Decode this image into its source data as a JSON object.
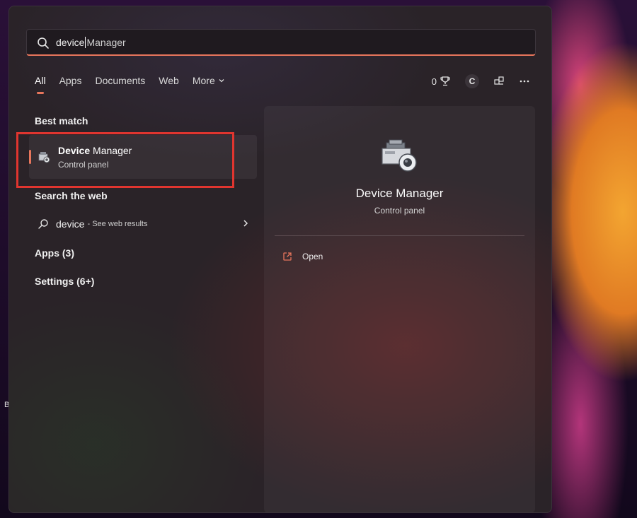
{
  "search": {
    "query_typed": "device",
    "query_suggest": " Manager"
  },
  "tabs": [
    {
      "label": "All",
      "active": true
    },
    {
      "label": "Apps"
    },
    {
      "label": "Documents"
    },
    {
      "label": "Web"
    },
    {
      "label": "More"
    }
  ],
  "header_icons": {
    "rewards_points": "0",
    "avatar_letter": "C"
  },
  "sections": {
    "best_match": "Best match",
    "search_web": "Search the web",
    "apps": "Apps (3)",
    "settings": "Settings (6+)"
  },
  "best_match": {
    "name_bold": "Device",
    "name_rest": " Manager",
    "subtitle": "Control panel"
  },
  "web_result": {
    "query": "device",
    "hint": "- See web results"
  },
  "detail": {
    "title": "Device Manager",
    "subtitle": "Control panel",
    "actions": [
      {
        "label": "Open"
      }
    ]
  },
  "stray_text": "B",
  "colors": {
    "accent": "#e8765c",
    "highlight_box": "#e0352f"
  },
  "icons": {
    "search": "search-icon",
    "chevron_down": "chevron-down-icon",
    "trophy": "trophy-icon",
    "share": "share-icon",
    "more": "more-icon",
    "device_manager": "device-manager-icon",
    "chevron_right": "chevron-right-icon",
    "open": "open-external-icon"
  }
}
